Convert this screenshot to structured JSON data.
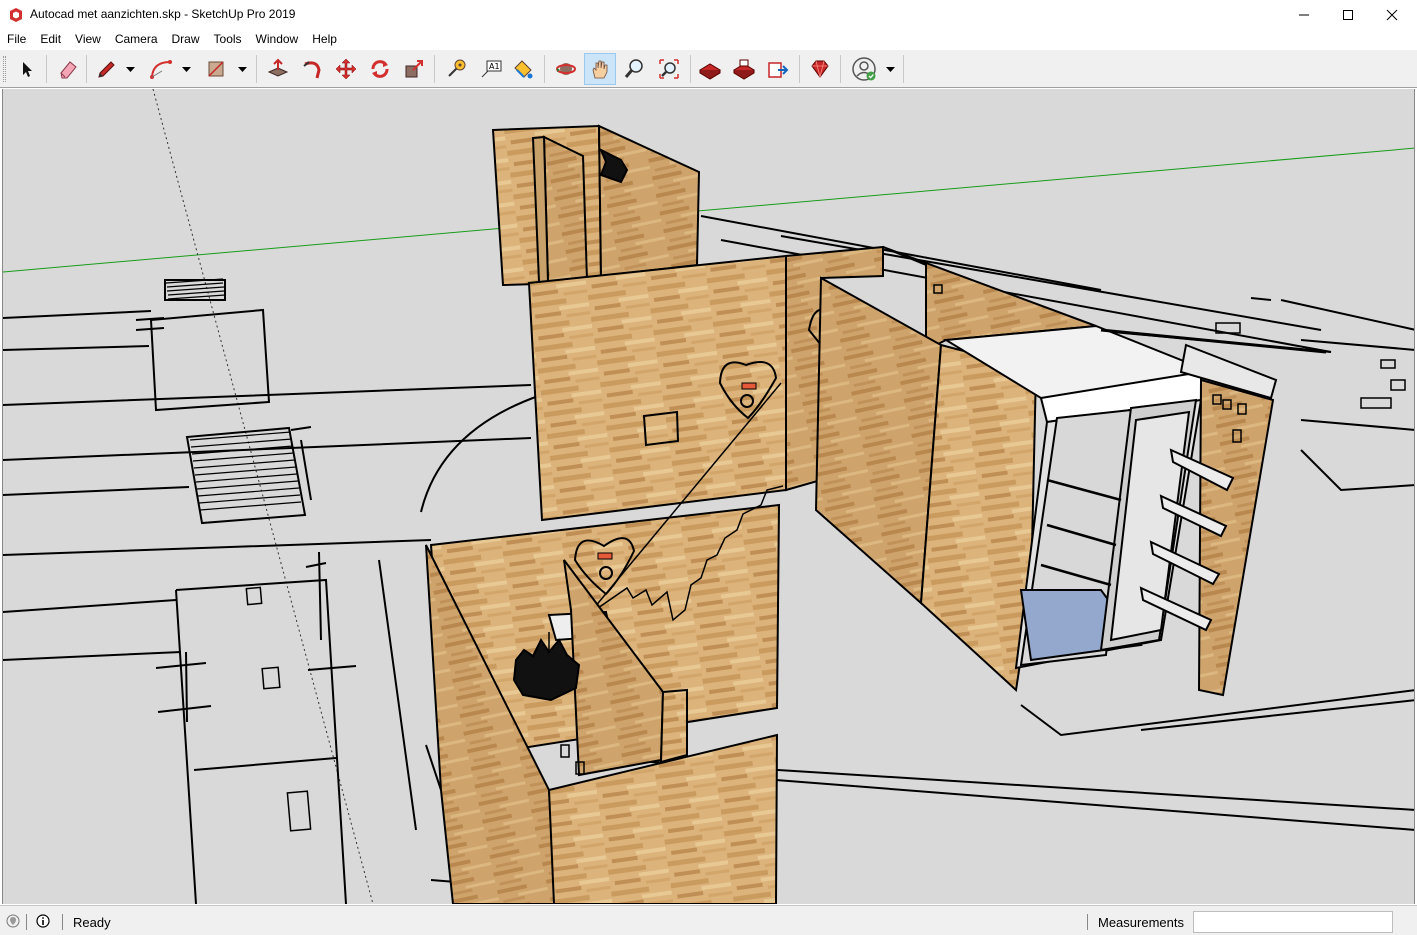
{
  "window": {
    "title": "Autocad met aanzichten.skp - SketchUp Pro 2019"
  },
  "menu": [
    "File",
    "Edit",
    "View",
    "Camera",
    "Draw",
    "Tools",
    "Window",
    "Help"
  ],
  "toolbar": {
    "tools": [
      {
        "icon": "select-arrow-icon",
        "label": "Select"
      },
      {
        "icon": "eraser-icon",
        "label": "Eraser"
      },
      {
        "icon": "pencil-line-icon",
        "label": "Line"
      },
      {
        "icon": "arc-icon",
        "label": "Arc"
      },
      {
        "icon": "rectangle-icon",
        "label": "Rectangle"
      },
      {
        "icon": "push-pull-icon",
        "label": "Push/Pull"
      },
      {
        "icon": "follow-me-icon",
        "label": "Follow Me"
      },
      {
        "icon": "move-icon",
        "label": "Move"
      },
      {
        "icon": "rotate-icon",
        "label": "Rotate"
      },
      {
        "icon": "scale-icon",
        "label": "Scale"
      },
      {
        "icon": "tape-measure-icon",
        "label": "Tape Measure"
      },
      {
        "icon": "text-label-icon",
        "label": "Text",
        "text": "A1"
      },
      {
        "icon": "paint-bucket-icon",
        "label": "Paint Bucket"
      },
      {
        "icon": "orbit-icon",
        "label": "Orbit"
      },
      {
        "icon": "pan-hand-icon",
        "label": "Pan",
        "active": true
      },
      {
        "icon": "zoom-icon",
        "label": "Zoom"
      },
      {
        "icon": "zoom-extents-icon",
        "label": "Zoom Extents"
      },
      {
        "icon": "warehouse-icon",
        "label": "3D Warehouse"
      },
      {
        "icon": "extension-warehouse-icon",
        "label": "Extension Warehouse"
      },
      {
        "icon": "layout-send-icon",
        "label": "Send to LayOut"
      },
      {
        "icon": "ruby-console-icon",
        "label": "Extension Manager"
      },
      {
        "icon": "user-account-icon",
        "label": "Account"
      }
    ]
  },
  "status": {
    "text": "Ready",
    "measurements_label": "Measurements",
    "measurements_value": ""
  },
  "colors": {
    "viewport_bg": "#d9d9d9",
    "wood": "#d9b07a",
    "wood_dark": "#b88a55",
    "green_axis": "#1a9b1a",
    "pan_active": "#cce4f7"
  }
}
